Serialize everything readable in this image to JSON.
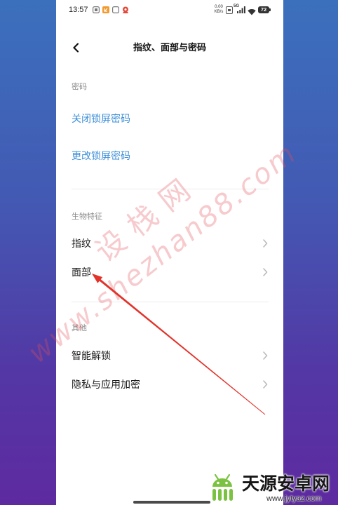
{
  "status_bar": {
    "time": "13:57",
    "left_icons": [
      "app-notification-icon",
      "app-notification-icon",
      "app-notification-icon",
      "app-notification-icon"
    ],
    "net_speed_value": "0.00",
    "net_speed_unit": "KB/s",
    "network": "5G",
    "battery": "72"
  },
  "header": {
    "back_icon": "chevron-left-icon",
    "title": "指纹、面部与密码"
  },
  "sections": [
    {
      "label": "密码",
      "items": [
        {
          "label": "关闭锁屏密码"
        },
        {
          "label": "更改锁屏密码"
        }
      ]
    },
    {
      "label": "生物特征",
      "items": [
        {
          "label": "指纹",
          "icon": "chevron-right-icon"
        },
        {
          "label": "面部",
          "icon": "chevron-right-icon"
        }
      ]
    },
    {
      "label": "其他",
      "items": [
        {
          "label": "智能解锁",
          "icon": "chevron-right-icon"
        },
        {
          "label": "隐私与应用加密",
          "icon": "chevron-right-icon"
        }
      ]
    }
  ],
  "watermark": {
    "site": "www.shezhan88.com",
    "brand": "设栈网"
  },
  "logo": {
    "icon": "android-robot-icon",
    "name": "天源安卓网",
    "url": "www.jytyaz.com"
  },
  "theme": {
    "link_color": "#3d8fd9",
    "arrow_color": "#e2332b",
    "logo_green": "#7cc242"
  }
}
